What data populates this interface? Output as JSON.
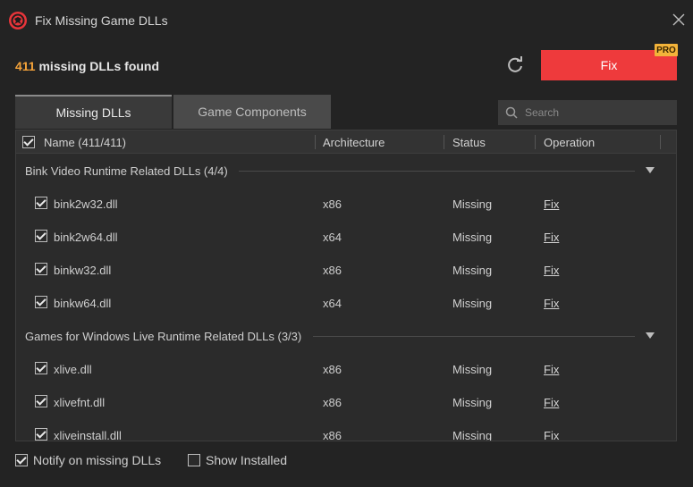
{
  "window": {
    "title": "Fix Missing Game DLLs"
  },
  "summary": {
    "count": "411",
    "text": "missing DLLs found"
  },
  "actions": {
    "fix_label": "Fix",
    "pro_badge": "PRO"
  },
  "tabs": [
    {
      "label": "Missing DLLs",
      "active": true
    },
    {
      "label": "Game Components",
      "active": false
    }
  ],
  "search": {
    "placeholder": "Search"
  },
  "table": {
    "columns": {
      "name": "Name (411/411)",
      "architecture": "Architecture",
      "status": "Status",
      "operation": "Operation"
    },
    "groups": [
      {
        "label": "Bink Video Runtime Related DLLs (4/4)",
        "rows": [
          {
            "name": "bink2w32.dll",
            "arch": "x86",
            "status": "Missing",
            "op": "Fix"
          },
          {
            "name": "bink2w64.dll",
            "arch": "x64",
            "status": "Missing",
            "op": "Fix"
          },
          {
            "name": "binkw32.dll",
            "arch": "x86",
            "status": "Missing",
            "op": "Fix"
          },
          {
            "name": "binkw64.dll",
            "arch": "x64",
            "status": "Missing",
            "op": "Fix"
          }
        ]
      },
      {
        "label": "Games for Windows Live Runtime Related DLLs (3/3)",
        "rows": [
          {
            "name": "xlive.dll",
            "arch": "x86",
            "status": "Missing",
            "op": "Fix"
          },
          {
            "name": "xlivefnt.dll",
            "arch": "x86",
            "status": "Missing",
            "op": "Fix"
          },
          {
            "name": "xliveinstall.dll",
            "arch": "x86",
            "status": "Missing",
            "op": "Fix"
          }
        ]
      }
    ]
  },
  "footer": {
    "notify_label": "Notify on missing DLLs",
    "notify_checked": true,
    "show_installed_label": "Show Installed",
    "show_installed_checked": false
  },
  "colors": {
    "accent_red": "#ee3a3c",
    "count_orange": "#f5a33a",
    "pro_gold": "#f3b33a"
  }
}
